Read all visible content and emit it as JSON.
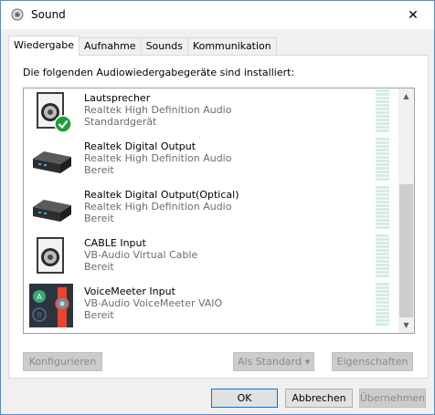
{
  "window": {
    "title": "Sound",
    "close_glyph": "✕"
  },
  "tabs": [
    {
      "label": "Wiedergabe",
      "active": true
    },
    {
      "label": "Aufnahme",
      "active": false
    },
    {
      "label": "Sounds",
      "active": false
    },
    {
      "label": "Kommunikation",
      "active": false
    }
  ],
  "panel": {
    "instruction": "Die folgenden Audiowiedergabegeräte sind installiert:"
  },
  "devices": [
    {
      "name": "Lautsprecher",
      "driver": "Realtek High Definition Audio",
      "status": "Standardgerät",
      "icon": "speaker-default-icon"
    },
    {
      "name": "Realtek Digital Output",
      "driver": "Realtek High Definition Audio",
      "status": "Bereit",
      "icon": "digital-output-icon"
    },
    {
      "name": "Realtek Digital Output(Optical)",
      "driver": "Realtek High Definition Audio",
      "status": "Bereit",
      "icon": "digital-output-icon"
    },
    {
      "name": "CABLE Input",
      "driver": "VB-Audio Virtual Cable",
      "status": "Bereit",
      "icon": "speaker-icon"
    },
    {
      "name": "VoiceMeeter Input",
      "driver": "VB-Audio VoiceMeeter VAIO",
      "status": "Bereit",
      "icon": "voicemeeter-icon"
    }
  ],
  "scrollbar": {
    "up_glyph": "▲",
    "down_glyph": "▼"
  },
  "buttons": {
    "configure": "Konfigurieren",
    "set_default": "Als Standard",
    "properties": "Eigenschaften",
    "ok": "OK",
    "cancel": "Abbrechen",
    "apply": "Übernehmen",
    "dropdown_glyph": "▼"
  },
  "colors": {
    "accent": "#0078d7",
    "check": "#1e9e3a",
    "meter": "#d6ece6"
  }
}
